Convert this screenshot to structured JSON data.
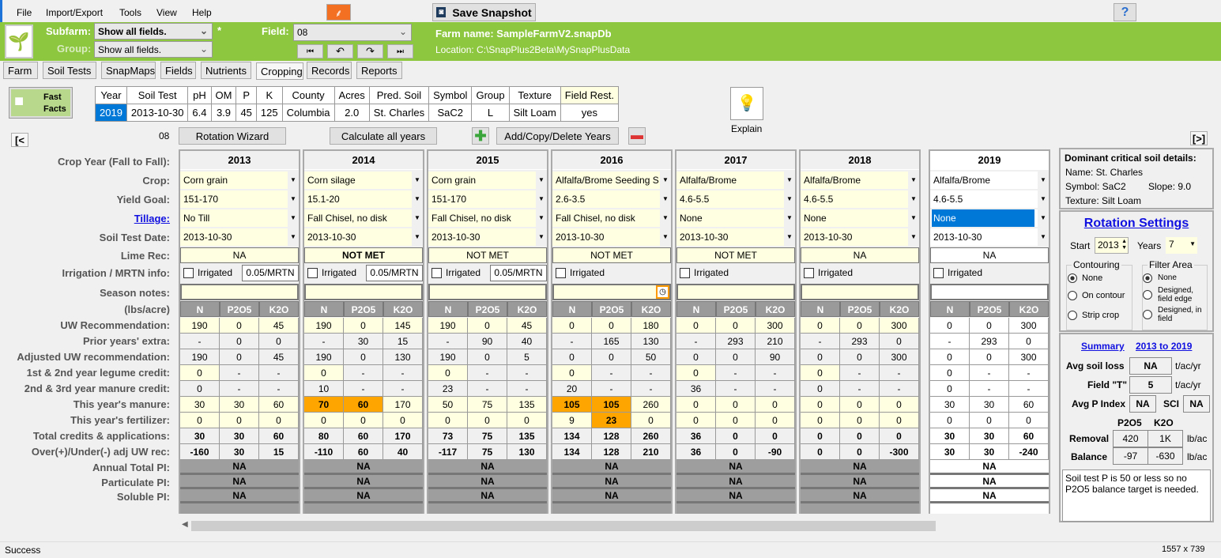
{
  "menu": [
    "File",
    "Import/Export",
    "Tools",
    "View",
    "Help"
  ],
  "toolbar": {
    "snapshot": "Save Snapshot",
    "help": "?"
  },
  "header": {
    "subfarm_label": "Subfarm:",
    "subfarm": "Show all fields.",
    "modified": "*",
    "group_label": "Group:",
    "group": "Show all fields.",
    "field_label": "Field:",
    "field": "08",
    "farm_name": "Farm name: SampleFarmV2.snapDb",
    "location": "Location: C:\\SnapPlus2Beta\\MySnapPlusData"
  },
  "tabs": [
    {
      "label": "Farm"
    },
    {
      "label": "Soil Tests"
    },
    {
      "label": "SnapMaps"
    },
    {
      "label": "Fields"
    },
    {
      "label": "Nutrients"
    },
    {
      "label": "Cropping",
      "active": true
    },
    {
      "label": "Records"
    },
    {
      "label": "Reports"
    }
  ],
  "fast_facts": {
    "label1": "Fast",
    "label2": "Facts",
    "headers": [
      "Year",
      "Soil Test",
      "pH",
      "OM",
      "P",
      "K",
      "County",
      "Acres",
      "Pred. Soil",
      "Symbol",
      "Group",
      "Texture",
      "Field Rest."
    ],
    "values": [
      "2019",
      "2013-10-30",
      "6.4",
      "3.9",
      "45",
      "125",
      "Columbia",
      "2.0",
      "St. Charles",
      "SaC2",
      "L",
      "Silt Loam",
      "yes"
    ]
  },
  "explain": "Explain",
  "actions": {
    "prev": "[<",
    "next": "[>]",
    "field": "08",
    "wizard": "Rotation Wizard",
    "calc": "Calculate all years",
    "addcopy": "Add/Copy/Delete Years"
  },
  "row_labels": [
    "Crop Year (Fall to Fall):",
    "Crop:",
    "Yield Goal:",
    "Tillage:",
    "Soil Test Date:",
    "Lime Rec:",
    "Irrigation / MRTN info:",
    "Season notes:",
    "(lbs/acre)",
    "UW Recommendation:",
    "Prior years' extra:",
    "Adjusted UW recommendation:",
    "1st & 2nd year legume credit:",
    "2nd & 3rd year manure credit:",
    "This year's manure:",
    "This year's fertilizer:",
    "Total credits & applications:",
    "Over(+)/Under(-) adj UW rec:",
    "Annual Total PI:",
    "Particulate PI:",
    "Soluble PI:"
  ],
  "nutrient_headers": [
    "N",
    "P2O5",
    "K2O"
  ],
  "irrigated_label": "Irrigated",
  "highlight_color": "#ffa500",
  "years": [
    {
      "year": "2013",
      "crop": "Corn grain",
      "yield": "151-170",
      "tillage": "No Till",
      "soil_date": "2013-10-30",
      "lime": "NA",
      "mrtn": "0.05/MRTN",
      "rows": [
        [
          "190",
          "0",
          "45"
        ],
        [
          "-",
          "0",
          "0"
        ],
        [
          "190",
          "0",
          "45"
        ],
        [
          "0",
          "-",
          "-"
        ],
        [
          "0",
          "-",
          "-"
        ],
        [
          "30",
          "30",
          "60"
        ],
        [
          "0",
          "0",
          "0"
        ],
        [
          "30",
          "30",
          "60"
        ],
        [
          "-160",
          "30",
          "15"
        ]
      ],
      "pi": [
        "NA",
        "NA",
        "NA"
      ],
      "hl": []
    },
    {
      "year": "2014",
      "crop": "Corn silage",
      "yield": "15.1-20",
      "tillage": "Fall Chisel, no disk",
      "soil_date": "2013-10-30",
      "lime": "NOT MET",
      "lime_bold": true,
      "mrtn": "0.05/MRTN",
      "rows": [
        [
          "190",
          "0",
          "145"
        ],
        [
          "-",
          "30",
          "15"
        ],
        [
          "190",
          "0",
          "130"
        ],
        [
          "0",
          "-",
          "-"
        ],
        [
          "10",
          "-",
          "-"
        ],
        [
          "70",
          "60",
          "170"
        ],
        [
          "0",
          "0",
          "0"
        ],
        [
          "80",
          "60",
          "170"
        ],
        [
          "-110",
          "60",
          "40"
        ]
      ],
      "pi": [
        "NA",
        "NA",
        "NA"
      ],
      "hl": [
        "5-0",
        "5-1"
      ]
    },
    {
      "year": "2015",
      "crop": "Corn grain",
      "yield": "151-170",
      "tillage": "Fall Chisel, no disk",
      "soil_date": "2013-10-30",
      "lime": "NOT MET",
      "mrtn": "0.05/MRTN",
      "rows": [
        [
          "190",
          "0",
          "45"
        ],
        [
          "-",
          "90",
          "40"
        ],
        [
          "190",
          "0",
          "5"
        ],
        [
          "0",
          "-",
          "-"
        ],
        [
          "23",
          "-",
          "-"
        ],
        [
          "50",
          "75",
          "135"
        ],
        [
          "0",
          "0",
          "0"
        ],
        [
          "73",
          "75",
          "135"
        ],
        [
          "-117",
          "75",
          "130"
        ]
      ],
      "pi": [
        "NA",
        "NA",
        "NA"
      ],
      "hl": []
    },
    {
      "year": "2016",
      "crop": "Alfalfa/Brome Seeding S",
      "yield": "2.6-3.5",
      "tillage": "Fall Chisel, no disk",
      "soil_date": "2013-10-30",
      "lime": "NOT MET",
      "notes_icon": true,
      "rows": [
        [
          "0",
          "0",
          "180"
        ],
        [
          "-",
          "165",
          "130"
        ],
        [
          "0",
          "0",
          "50"
        ],
        [
          "0",
          "-",
          "-"
        ],
        [
          "20",
          "-",
          "-"
        ],
        [
          "105",
          "105",
          "260"
        ],
        [
          "9",
          "23",
          "0"
        ],
        [
          "134",
          "128",
          "260"
        ],
        [
          "134",
          "128",
          "210"
        ]
      ],
      "pi": [
        "NA",
        "NA",
        "NA"
      ],
      "hl": [
        "5-0",
        "5-1",
        "6-1"
      ]
    },
    {
      "year": "2017",
      "crop": "Alfalfa/Brome",
      "yield": "4.6-5.5",
      "tillage": "None",
      "soil_date": "2013-10-30",
      "lime": "NOT MET",
      "rows": [
        [
          "0",
          "0",
          "300"
        ],
        [
          "-",
          "293",
          "210"
        ],
        [
          "0",
          "0",
          "90"
        ],
        [
          "0",
          "-",
          "-"
        ],
        [
          "36",
          "-",
          "-"
        ],
        [
          "0",
          "0",
          "0"
        ],
        [
          "0",
          "0",
          "0"
        ],
        [
          "36",
          "0",
          "0"
        ],
        [
          "36",
          "0",
          "-90"
        ]
      ],
      "pi": [
        "NA",
        "NA",
        "NA"
      ],
      "hl": []
    },
    {
      "year": "2018",
      "crop": "Alfalfa/Brome",
      "yield": "4.6-5.5",
      "tillage": "None",
      "soil_date": "2013-10-30",
      "lime": "NA",
      "rows": [
        [
          "0",
          "0",
          "300"
        ],
        [
          "-",
          "293",
          "0"
        ],
        [
          "0",
          "0",
          "300"
        ],
        [
          "0",
          "-",
          "-"
        ],
        [
          "0",
          "-",
          "-"
        ],
        [
          "0",
          "0",
          "0"
        ],
        [
          "0",
          "0",
          "0"
        ],
        [
          "0",
          "0",
          "0"
        ],
        [
          "0",
          "0",
          "-300"
        ]
      ],
      "pi": [
        "NA",
        "NA",
        "NA"
      ],
      "hl": []
    },
    {
      "year": "2019",
      "crop": "Alfalfa/Brome",
      "yield": "4.6-5.5",
      "tillage": "None",
      "soil_date": "2013-10-30",
      "lime": "NA",
      "current": true,
      "rows": [
        [
          "0",
          "0",
          "300"
        ],
        [
          "-",
          "293",
          "0"
        ],
        [
          "0",
          "0",
          "300"
        ],
        [
          "0",
          "-",
          "-"
        ],
        [
          "0",
          "-",
          "-"
        ],
        [
          "30",
          "30",
          "60"
        ],
        [
          "0",
          "0",
          "0"
        ],
        [
          "30",
          "30",
          "60"
        ],
        [
          "30",
          "30",
          "-240"
        ]
      ],
      "pi": [
        "NA",
        "NA",
        "NA"
      ],
      "hl": []
    }
  ],
  "soil_details": {
    "title": "Dominant critical soil details:",
    "name": "Name:   St. Charles",
    "symbol": "Symbol:  SaC2",
    "slope": "Slope: 9.0",
    "texture": "Texture:  Silt Loam"
  },
  "rotation": {
    "title": "Rotation Settings",
    "start_label": "Start",
    "start": "2013",
    "years_label": "Years",
    "years": "7",
    "contouring": "Contouring",
    "contour_opts": [
      "None",
      "On contour",
      "Strip crop"
    ],
    "filter": "Filter Area",
    "filter_opts": [
      "None",
      "Designed, field edge",
      "Designed, in field"
    ]
  },
  "summary": {
    "title": "Summary",
    "range": "2013 to 2019",
    "soil_loss_label": "Avg soil loss",
    "soil_loss": "NA",
    "unit1": "t/ac/yr",
    "t_label": "Field \"T\"",
    "t": "5",
    "unit2": "t/ac/yr",
    "pindex_label": "Avg P Index",
    "pindex": "NA",
    "sci_label": "SCI",
    "sci": "NA",
    "p_hdr": "P2O5",
    "k_hdr": "K2O",
    "removal_label": "Removal",
    "removal_p": "420",
    "removal_k": "1K",
    "balance_label": "Balance",
    "balance_p": "-97",
    "balance_k": "-630",
    "unit3": "lb/ac",
    "unit4": "lb/ac",
    "note": "Soil test P is 50 or less so no P2O5 balance target is needed."
  },
  "status": {
    "text": "Success",
    "size": "1557 x 739"
  }
}
